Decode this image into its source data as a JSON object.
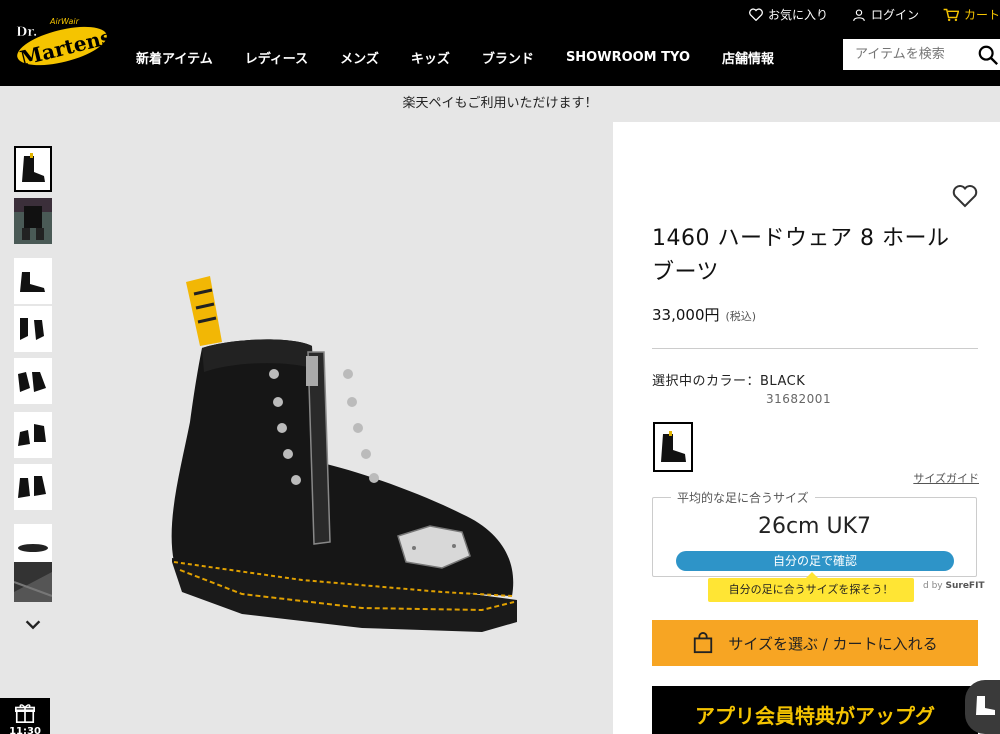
{
  "header": {
    "logo_text": "Dr. Martens AirWair",
    "util": {
      "favorites": "お気に入り",
      "login": "ログイン",
      "cart": "カート"
    },
    "nav": [
      "新着アイテム",
      "レディース",
      "メンズ",
      "キッズ",
      "ブランド",
      "SHOWROOM TYO",
      "店舗情報"
    ],
    "search_placeholder": "アイテムを検索",
    "brand_color": "#f5c400"
  },
  "banner": "楽天ペイもご利用いただけます！",
  "gallery": {
    "thumbnail_count": 9,
    "selected_index": 0
  },
  "product": {
    "title": "1460 ハードウェア 8 ホール ブーツ",
    "price": "33,000円",
    "tax": "(税込)",
    "color_label": "選択中のカラー：BLACK",
    "sku": "31682001",
    "size_guide": "サイズガイド",
    "fit": {
      "legend": "平均的な足に合うサイズ",
      "size": "26cm UK7",
      "button": "自分の足で確認",
      "tooltip": "自分の足に合うサイズを探そう！",
      "powered_prefix": "d by",
      "powered_brand": "SureFIT"
    },
    "cart_button": "サイズを選ぶ / カートに入れる",
    "app_banner": "アプリ会員特典がアップグ",
    "cta_color": "#f7a523",
    "fit_button_color": "#2e94c8"
  },
  "floating": {
    "gift_time": "11:30"
  }
}
